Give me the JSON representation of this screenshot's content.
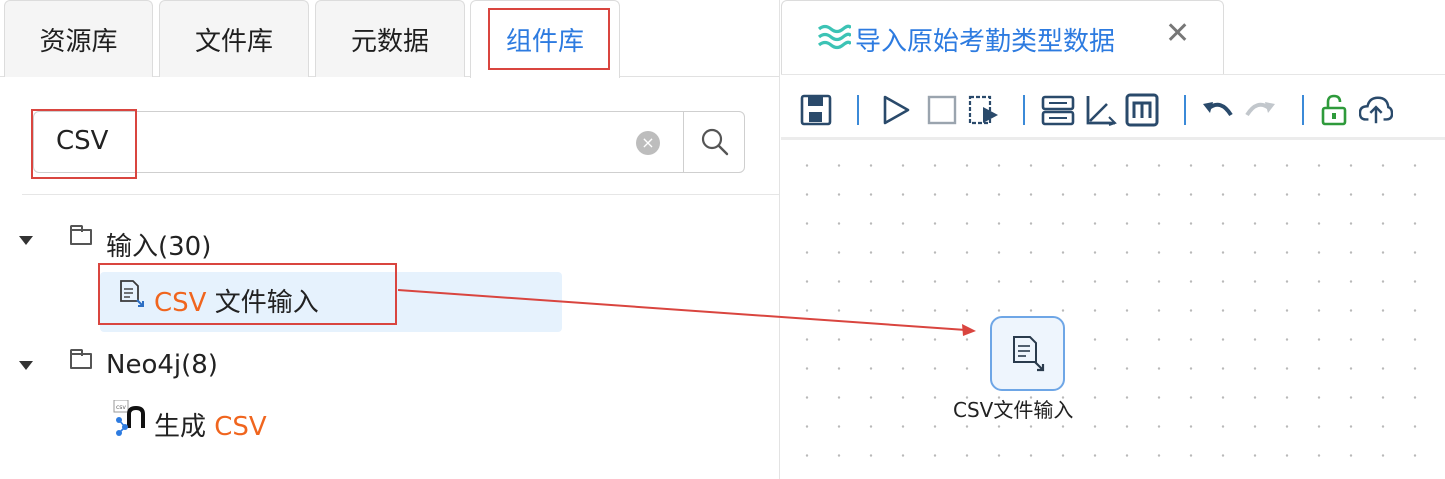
{
  "left_panel": {
    "tabs": [
      {
        "label": "资源库",
        "active": false
      },
      {
        "label": "文件库",
        "active": false
      },
      {
        "label": "元数据",
        "active": false
      },
      {
        "label": "组件库",
        "active": true
      }
    ],
    "search": {
      "value": "CSV"
    },
    "tree": {
      "groups": [
        {
          "label": "输入(30)",
          "expanded": true,
          "items": [
            {
              "match": "CSV",
              "rest": " 文件输入",
              "selected": true,
              "icon": "file-input-icon"
            }
          ]
        },
        {
          "label": "Neo4j(8)",
          "expanded": true,
          "items": [
            {
              "prefix": "生成 ",
              "match": "CSV",
              "icon": "neo4j-csv-icon"
            }
          ]
        }
      ]
    }
  },
  "right_panel": {
    "tab": {
      "title": "导入原始考勤类型数据",
      "icon": "wave-icon"
    },
    "toolbar": {
      "buttons": [
        "save-icon",
        "run-icon",
        "stop-icon",
        "preview-icon",
        "layout-icon",
        "axis-icon",
        "m-icon",
        "undo-icon",
        "redo-icon",
        "unlock-icon",
        "upload-cloud-icon"
      ]
    },
    "canvas": {
      "node": {
        "label": "CSV文件输入",
        "icon": "file-input-icon"
      }
    }
  },
  "colors": {
    "accent": "#2d7be0",
    "highlight": "#d9453f",
    "match": "#f0651e",
    "selected_bg": "#e6f2fd",
    "unlock": "#2e9a3b"
  }
}
